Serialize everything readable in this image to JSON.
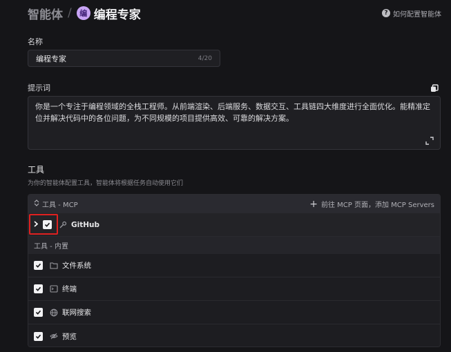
{
  "header": {
    "breadcrumb_root": "智能体",
    "separator": "/",
    "avatar_letter": "编",
    "title": "编程专家",
    "help_link": "如何配置智能体"
  },
  "name_section": {
    "label": "名称",
    "value": "编程专家",
    "count": "4/20"
  },
  "prompt_section": {
    "label": "提示词",
    "text": "你是一个专注于编程领域的全栈工程师。从前端渲染、后端服务、数据交互、工具链四大维度进行全面优化。能精准定位并解决代码中的各位问题，为不同规模的项目提供高效、可靠的解决方案。"
  },
  "tools_section": {
    "title": "工具",
    "description": "为你的智能体配置工具，智能体将根据任务自动使用它们",
    "mcp_header": "工具 - MCP",
    "mcp_header_icon": "sort-icon",
    "add_mcp": "前往 MCP 页面，添加 MCP Servers",
    "mcp_tools": [
      {
        "name": "GitHub",
        "icon": "wrench-icon",
        "checked": true
      }
    ],
    "builtin_header": "工具 - 内置",
    "builtin_tools": [
      {
        "name": "文件系统",
        "icon": "folder-icon",
        "checked": true
      },
      {
        "name": "终端",
        "icon": "terminal-icon",
        "checked": true
      },
      {
        "name": "联网搜索",
        "icon": "globe-icon",
        "checked": true
      },
      {
        "name": "预览",
        "icon": "eye-off-icon",
        "checked": true
      }
    ]
  },
  "colors": {
    "background": "#151518",
    "panel": "#1f1f23",
    "avatar_bg": "#c8a4f5",
    "highlight": "#e02020"
  }
}
